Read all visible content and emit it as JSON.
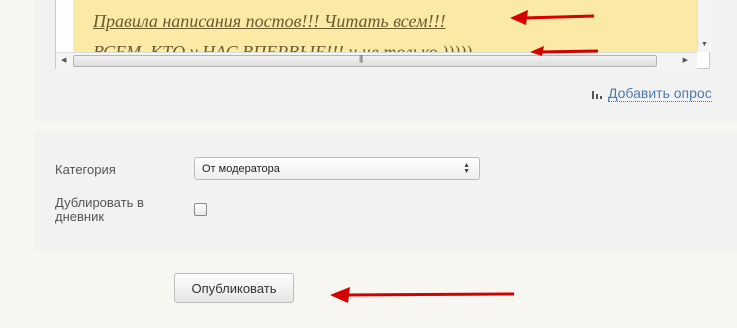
{
  "editor": {
    "lines": [
      "",
      "Правила написания постов!!! Читать всем!!!",
      "ВСЕМ, КТО у НАС ВПЕРВЫЕ!!! и не только )))))"
    ],
    "background_color": "#fbe9a6",
    "text_color": "#6b5a2d"
  },
  "add_poll": {
    "label": "Добавить опрос",
    "icon": "bar-chart-icon",
    "color": "#4a7bb0"
  },
  "form": {
    "category_label": "Категория",
    "category_value": "От модератора",
    "duplicate_label": "Дублировать в дневник",
    "duplicate_checked": false
  },
  "actions": {
    "publish_label": "Опубликовать"
  },
  "annotations": {
    "arrow_icon": "red-arrow-icon",
    "arrow_color": "#d40000"
  }
}
